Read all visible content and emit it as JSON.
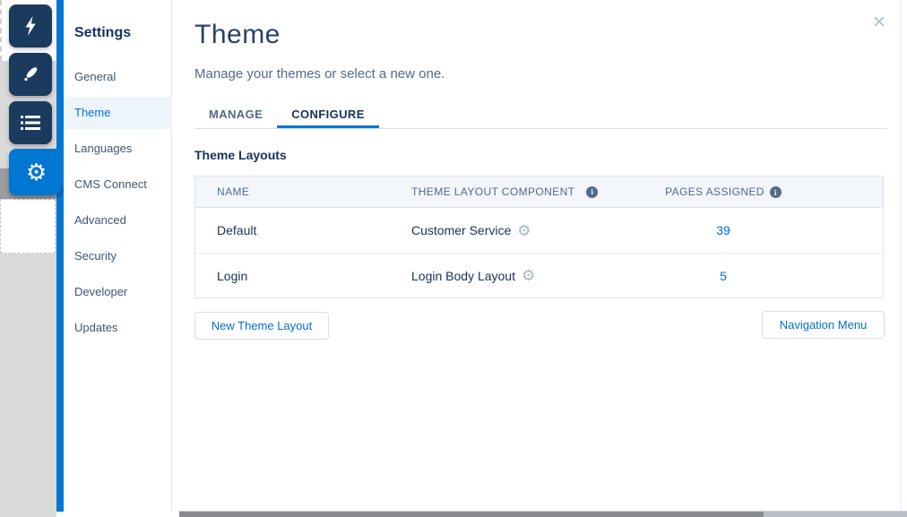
{
  "colors": {
    "accent_blue": "#0176d3",
    "navy": "#16325c",
    "secondary_text": "#54698d",
    "link_blue": "#0170d2",
    "rail_button": "#1a3b5d",
    "selected_item_bg": "#eef4fb",
    "table_header_bg": "#f3f6fa",
    "border": "#dce3ec"
  },
  "icons": {
    "gear": "⚙",
    "close": "✕",
    "info": "i"
  },
  "icon_rail": {
    "items": [
      {
        "name": "lightning",
        "active": false
      },
      {
        "name": "brush",
        "active": false
      },
      {
        "name": "list",
        "active": false
      },
      {
        "name": "gear",
        "active": true
      }
    ]
  },
  "sidebar": {
    "title": "Settings",
    "items": [
      {
        "label": "General",
        "selected": false
      },
      {
        "label": "Theme",
        "selected": true
      },
      {
        "label": "Languages",
        "selected": false
      },
      {
        "label": "CMS Connect",
        "selected": false
      },
      {
        "label": "Advanced",
        "selected": false
      },
      {
        "label": "Security",
        "selected": false
      },
      {
        "label": "Developer",
        "selected": false
      },
      {
        "label": "Updates",
        "selected": false
      }
    ]
  },
  "main": {
    "title": "Theme",
    "subtitle": "Manage your themes or select a new one.",
    "tabs": [
      {
        "label": "MANAGE",
        "active": false
      },
      {
        "label": "CONFIGURE",
        "active": true
      }
    ],
    "section_title": "Theme Layouts",
    "table": {
      "columns": [
        {
          "label": "NAME",
          "info": false
        },
        {
          "label": "THEME LAYOUT COMPONENT",
          "info": true
        },
        {
          "label": "PAGES ASSIGNED",
          "info": true
        }
      ],
      "rows": [
        {
          "name": "Default",
          "component": "Customer Service",
          "pages": "39"
        },
        {
          "name": "Login",
          "component": "Login Body Layout",
          "pages": "5"
        }
      ]
    },
    "buttons": {
      "new_theme_layout": "New Theme Layout",
      "navigation_menu": "Navigation Menu"
    }
  }
}
